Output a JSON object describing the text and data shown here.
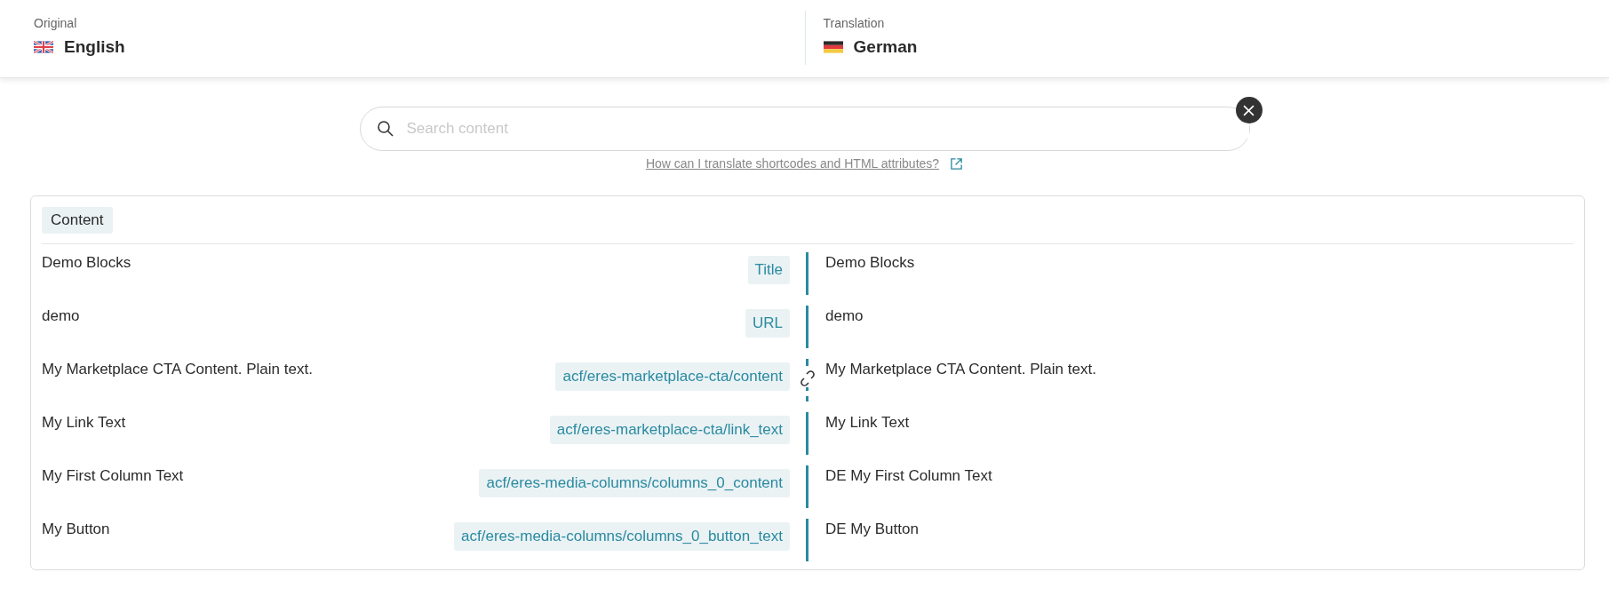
{
  "header": {
    "original": {
      "label": "Original",
      "language": "English",
      "kind": "uk"
    },
    "translation": {
      "label": "Translation",
      "language": "German",
      "kind": "de"
    }
  },
  "search": {
    "placeholder": "Search content"
  },
  "help_link": "How can I translate shortcodes and HTML attributes?",
  "section": {
    "title": "Content"
  },
  "rows": [
    {
      "original": "Demo Blocks",
      "field": "Title",
      "linked": false,
      "translation": "Demo Blocks"
    },
    {
      "original": "demo",
      "field": "URL",
      "linked": false,
      "translation": "demo"
    },
    {
      "original": "My Marketplace CTA Content. Plain text.",
      "field": "acf/eres-marketplace-cta/content",
      "linked": true,
      "translation": "My Marketplace CTA Content. Plain text."
    },
    {
      "original": "My Link Text",
      "field": "acf/eres-marketplace-cta/link_text",
      "linked": false,
      "translation": "My Link Text"
    },
    {
      "original": "My First Column Text",
      "field": "acf/eres-media-columns/columns_0_content",
      "linked": false,
      "translation": "DE My First Column Text"
    },
    {
      "original": "My Button",
      "field": "acf/eres-media-columns/columns_0_button_text",
      "linked": false,
      "translation": "DE My Button"
    }
  ]
}
